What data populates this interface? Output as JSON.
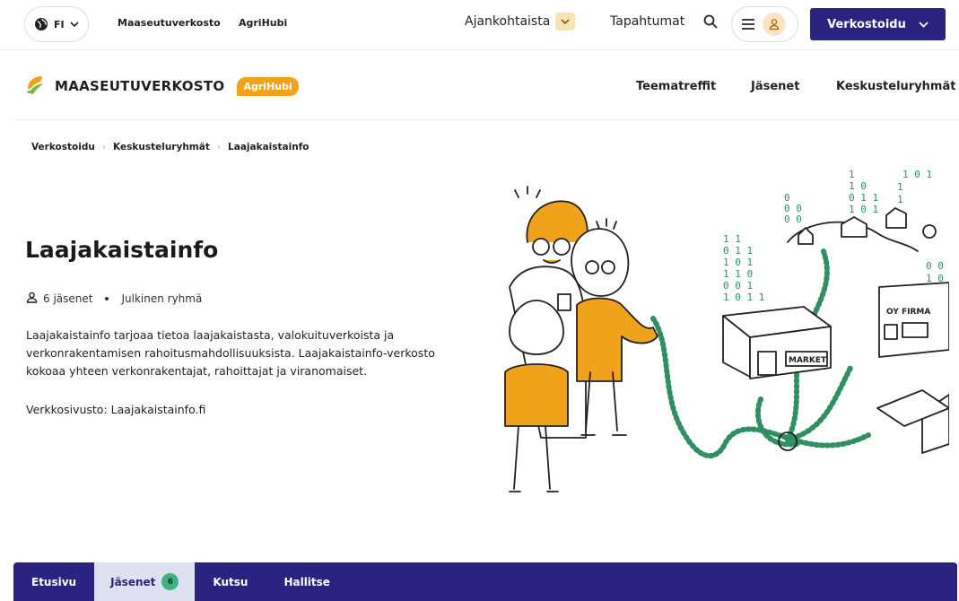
{
  "topbar": {
    "lang": "FI",
    "links": [
      "Maaseutuverkosto",
      "AgriHubi"
    ],
    "ajankohtaista": "Ajankohtaista",
    "tapahtumat": "Tapahtumat",
    "verkostoidu_button": "Verkostoidu"
  },
  "brand": {
    "logo_text": "MAASEUTUVERKOSTO",
    "badge": "AgriHubi",
    "nav": [
      "Teematreffit",
      "Jäsenet",
      "Keskusteluryhmät"
    ]
  },
  "breadcrumb": [
    "Verkostoidu",
    "Keskusteluryhmät",
    "Laajakaistainfo"
  ],
  "group": {
    "title": "Laajakaistainfo",
    "members": "6 jäsenet",
    "visibility": "Julkinen ryhmä",
    "description": "Laajakaistainfo tarjoaa tietoa laajakaistasta, valokuituverkoista ja verkonrakentamisen rahoitusmahdollisuuksista. Laajakaistainfo-verkosto kokoaa yhteen verkonrakentajat, rahoittajat ja viranomaiset.",
    "website": "Verkkosivusto: Laajakaistainfo.fi"
  },
  "illustration": {
    "market_sign": "MARKET",
    "firma_sign": "OY FIRMA"
  },
  "tabs": [
    {
      "label": "Etusivu"
    },
    {
      "label": "Jäsenet",
      "badge": "6"
    },
    {
      "label": "Kutsu"
    },
    {
      "label": "Hallitse"
    }
  ],
  "colors": {
    "primary": "#2a237f",
    "accent": "#f0a21a",
    "badge": "#3fb37f"
  }
}
